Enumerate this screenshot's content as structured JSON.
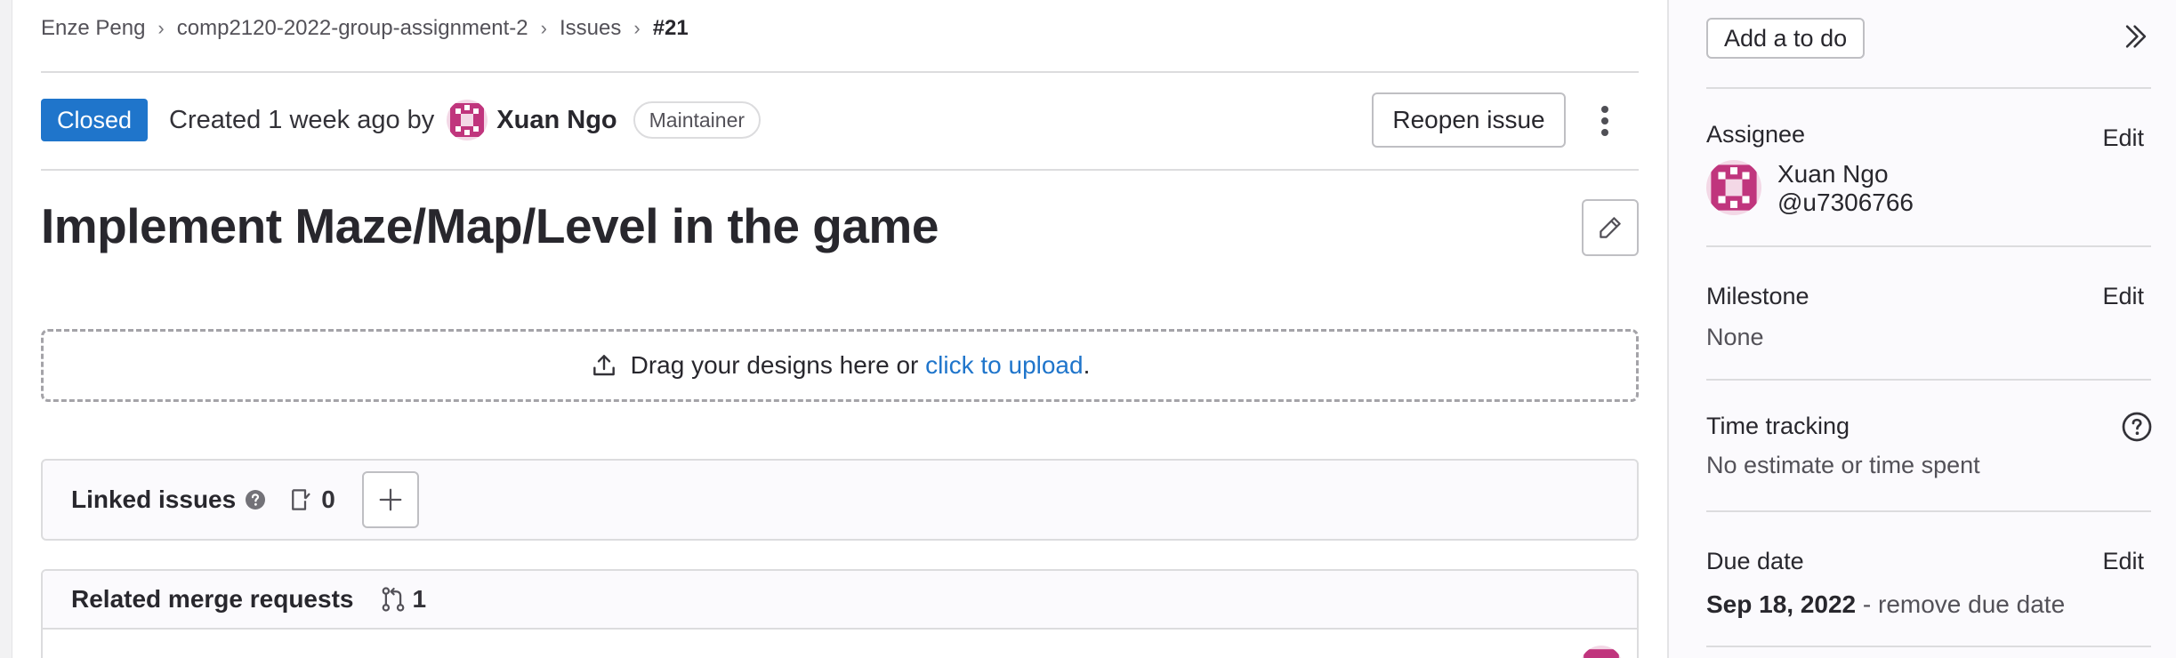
{
  "breadcrumb": {
    "items": [
      "Enze Peng",
      "comp2120-2022-group-assignment-2",
      "Issues",
      "#21"
    ]
  },
  "issue": {
    "status": "Closed",
    "created_text": "Created 1 week ago by",
    "author": "Xuan Ngo",
    "author_role": "Maintainer",
    "reopen_label": "Reopen issue",
    "title": "Implement Maze/Map/Level in the game"
  },
  "design_upload": {
    "text": "Drag your designs here or",
    "link": "click to upload",
    "suffix": "."
  },
  "linked_issues": {
    "title": "Linked issues",
    "count": "0"
  },
  "merge_requests": {
    "title": "Related merge requests",
    "count": "1"
  },
  "sidebar": {
    "todo_label": "Add a to do",
    "edit_label": "Edit",
    "assignee": {
      "label": "Assignee",
      "name": "Xuan Ngo",
      "handle": "@u7306766"
    },
    "milestone": {
      "label": "Milestone",
      "value": "None"
    },
    "time_tracking": {
      "label": "Time tracking",
      "value": "No estimate or time spent"
    },
    "due_date": {
      "label": "Due date",
      "date": "Sep 18, 2022",
      "separator": " - ",
      "remove": "remove due date"
    }
  },
  "colors": {
    "status_closed": "#1f75cb",
    "link": "#1f75cb",
    "avatar": "#c0357d"
  },
  "icons": [
    "chevron-right-icon",
    "kebab-icon",
    "pencil-icon",
    "upload-icon",
    "question-icon",
    "issues-icon",
    "plus-icon",
    "merge-request-icon",
    "double-chevron-right-icon",
    "avatar-identicon"
  ]
}
